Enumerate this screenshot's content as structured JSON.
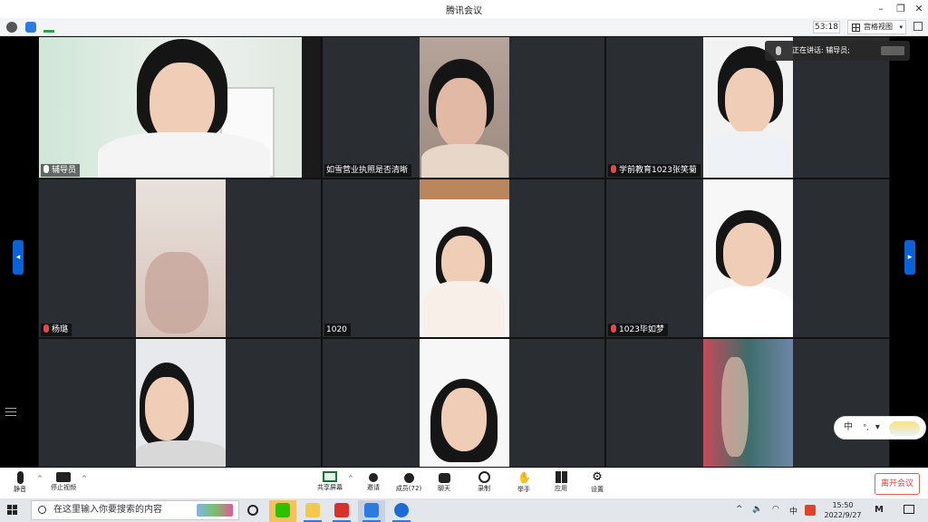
{
  "window": {
    "title": "腾讯会议"
  },
  "infobar": {
    "timer": "53:18",
    "view_label": "宫格视图"
  },
  "speaking": {
    "label": "正在讲话: 辅导员;"
  },
  "participants": [
    {
      "name": "辅导员",
      "muted": false
    },
    {
      "name": "如雪营业执照是否清晰",
      "muted": false
    },
    {
      "name": "学前教育1023张笑菊",
      "muted": true
    },
    {
      "name": "杨璐",
      "muted": true
    },
    {
      "name": "1020",
      "muted": false
    },
    {
      "name": "1023毕如梦",
      "muted": true
    },
    {
      "name": "",
      "muted": false
    },
    {
      "name": "",
      "muted": false
    },
    {
      "name": "",
      "muted": false
    }
  ],
  "toolbar": {
    "mute": "静音",
    "stop_video": "停止视频",
    "share_screen": "共享屏幕",
    "invite": "邀请",
    "members": "成员(72)",
    "chat": "聊天",
    "record": "录制",
    "raise_hand": "举手",
    "apps": "应用",
    "settings": "设置",
    "leave": "离开会议"
  },
  "ime": {
    "label": "中"
  },
  "taskbar": {
    "search_placeholder": "在这里输入你要搜索的内容",
    "time": "15:50",
    "date": "2022/9/27",
    "ime_indicator": "中"
  },
  "colors": {
    "accent": "#0a62d6",
    "leave": "#e03c3c",
    "tile_bg": "#2a2d31"
  }
}
